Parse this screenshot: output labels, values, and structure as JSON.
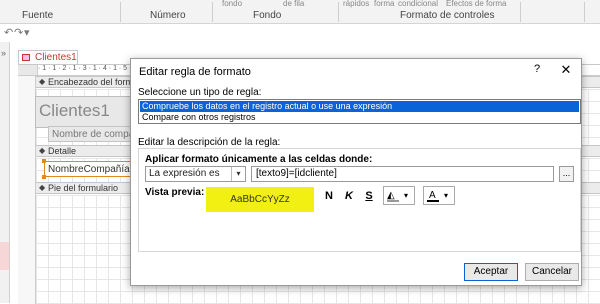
{
  "ribbon": {
    "top_fragments": [
      "fondo",
      "de fila",
      "rápidos",
      "forma",
      "condicional",
      "Efectos de forma"
    ],
    "groups": [
      "Fuente",
      "Número",
      "Fondo",
      "Formato de controles"
    ]
  },
  "quick_access": {
    "undo_glyph": "↶",
    "redo_glyph": "↷",
    "customize_glyph": "▾"
  },
  "form_tab": {
    "label": "Clientes1"
  },
  "form_design": {
    "ruler_ticks": "· 1 · 1 · 2 · 1 · 3 · 1 · 4 · 1 · 5 · 1 · 6 · 1 · 7 · 1 · 8 · 1 · 9 · 1 · 10 · 1 · 11 · 1 · 12 · 1 · 13 · 1 · 14 · 1 · 15",
    "header_section": "Encabezado del formulario",
    "title_control": "Clientes1",
    "name_label": "Nombre de compañía",
    "detail_section": "Detalle",
    "field_control": "NombreCompañía",
    "footer_section": "Pie del formulario"
  },
  "dialog": {
    "title": "Editar regla de formato",
    "help": "?",
    "close": "✕",
    "select_rule_type_label": "Seleccione un tipo de regla:",
    "rule_types": [
      "Compruebe los datos en el registro actual o use una expresión",
      "Compare con otros registros"
    ],
    "edit_description_label": "Editar la descripción de la regla:",
    "apply_format_label": "Aplicar formato únicamente a las celdas donde:",
    "condition_value": "La expresión es",
    "expression_value": "[texto9]=[idcliente]",
    "expression_builder": "...",
    "preview_label": "Vista previa:",
    "preview_sample": "AaBbCcYyZz",
    "bold": "N",
    "italic": "K",
    "underline": "S",
    "fill_glyph": "◭",
    "font_color_glyph": "A",
    "dropdown_glyph": "▾",
    "ok_button": "Aceptar",
    "cancel_button": "Cancelar"
  },
  "colors": {
    "selection": "#0a64d8",
    "preview_fill": "#f2ef12",
    "control_border": "#e08a1e",
    "tab_text": "#c0392b"
  }
}
